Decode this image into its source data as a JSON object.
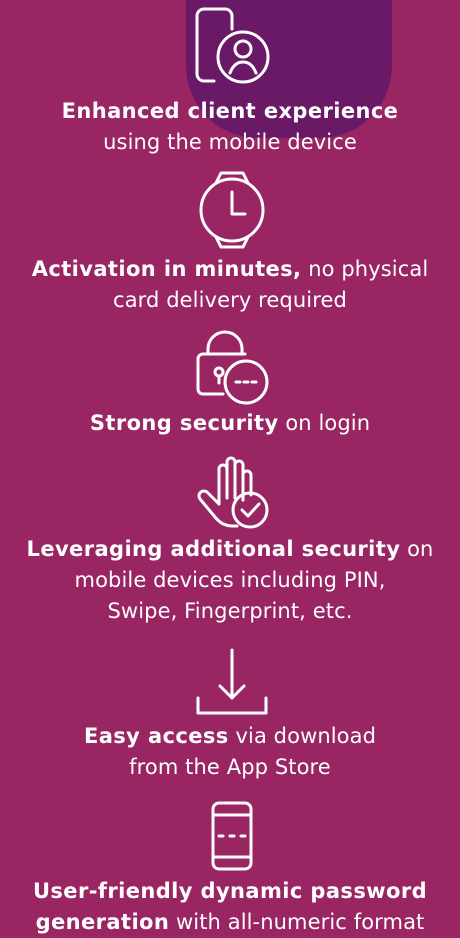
{
  "colors": {
    "background": "#9a2563",
    "accent_shape": "#6a1966",
    "foreground": "#ffffff"
  },
  "features": [
    {
      "icon": "phone-user-icon",
      "bold": "Enhanced client experience",
      "rest": "",
      "line2": "using the mobile device"
    },
    {
      "icon": "watch-clock-icon",
      "bold": "Activation in minutes,",
      "rest": " no physical",
      "line2": "card delivery required"
    },
    {
      "icon": "lock-password-icon",
      "bold": "Strong security",
      "rest": " on login"
    },
    {
      "icon": "hand-check-icon",
      "bold": "Leveraging additional security",
      "rest": " on",
      "line2": "mobile devices including PIN,",
      "line3": "Swipe, Fingerprint, etc."
    },
    {
      "icon": "download-icon",
      "bold": "Easy access",
      "rest": " via download",
      "line2": "from the App Store"
    },
    {
      "icon": "phone-password-icon",
      "bold": "User-friendly dynamic password",
      "rest": "",
      "line2_bold": "generation",
      "line2_rest": " with all-numeric format"
    }
  ]
}
